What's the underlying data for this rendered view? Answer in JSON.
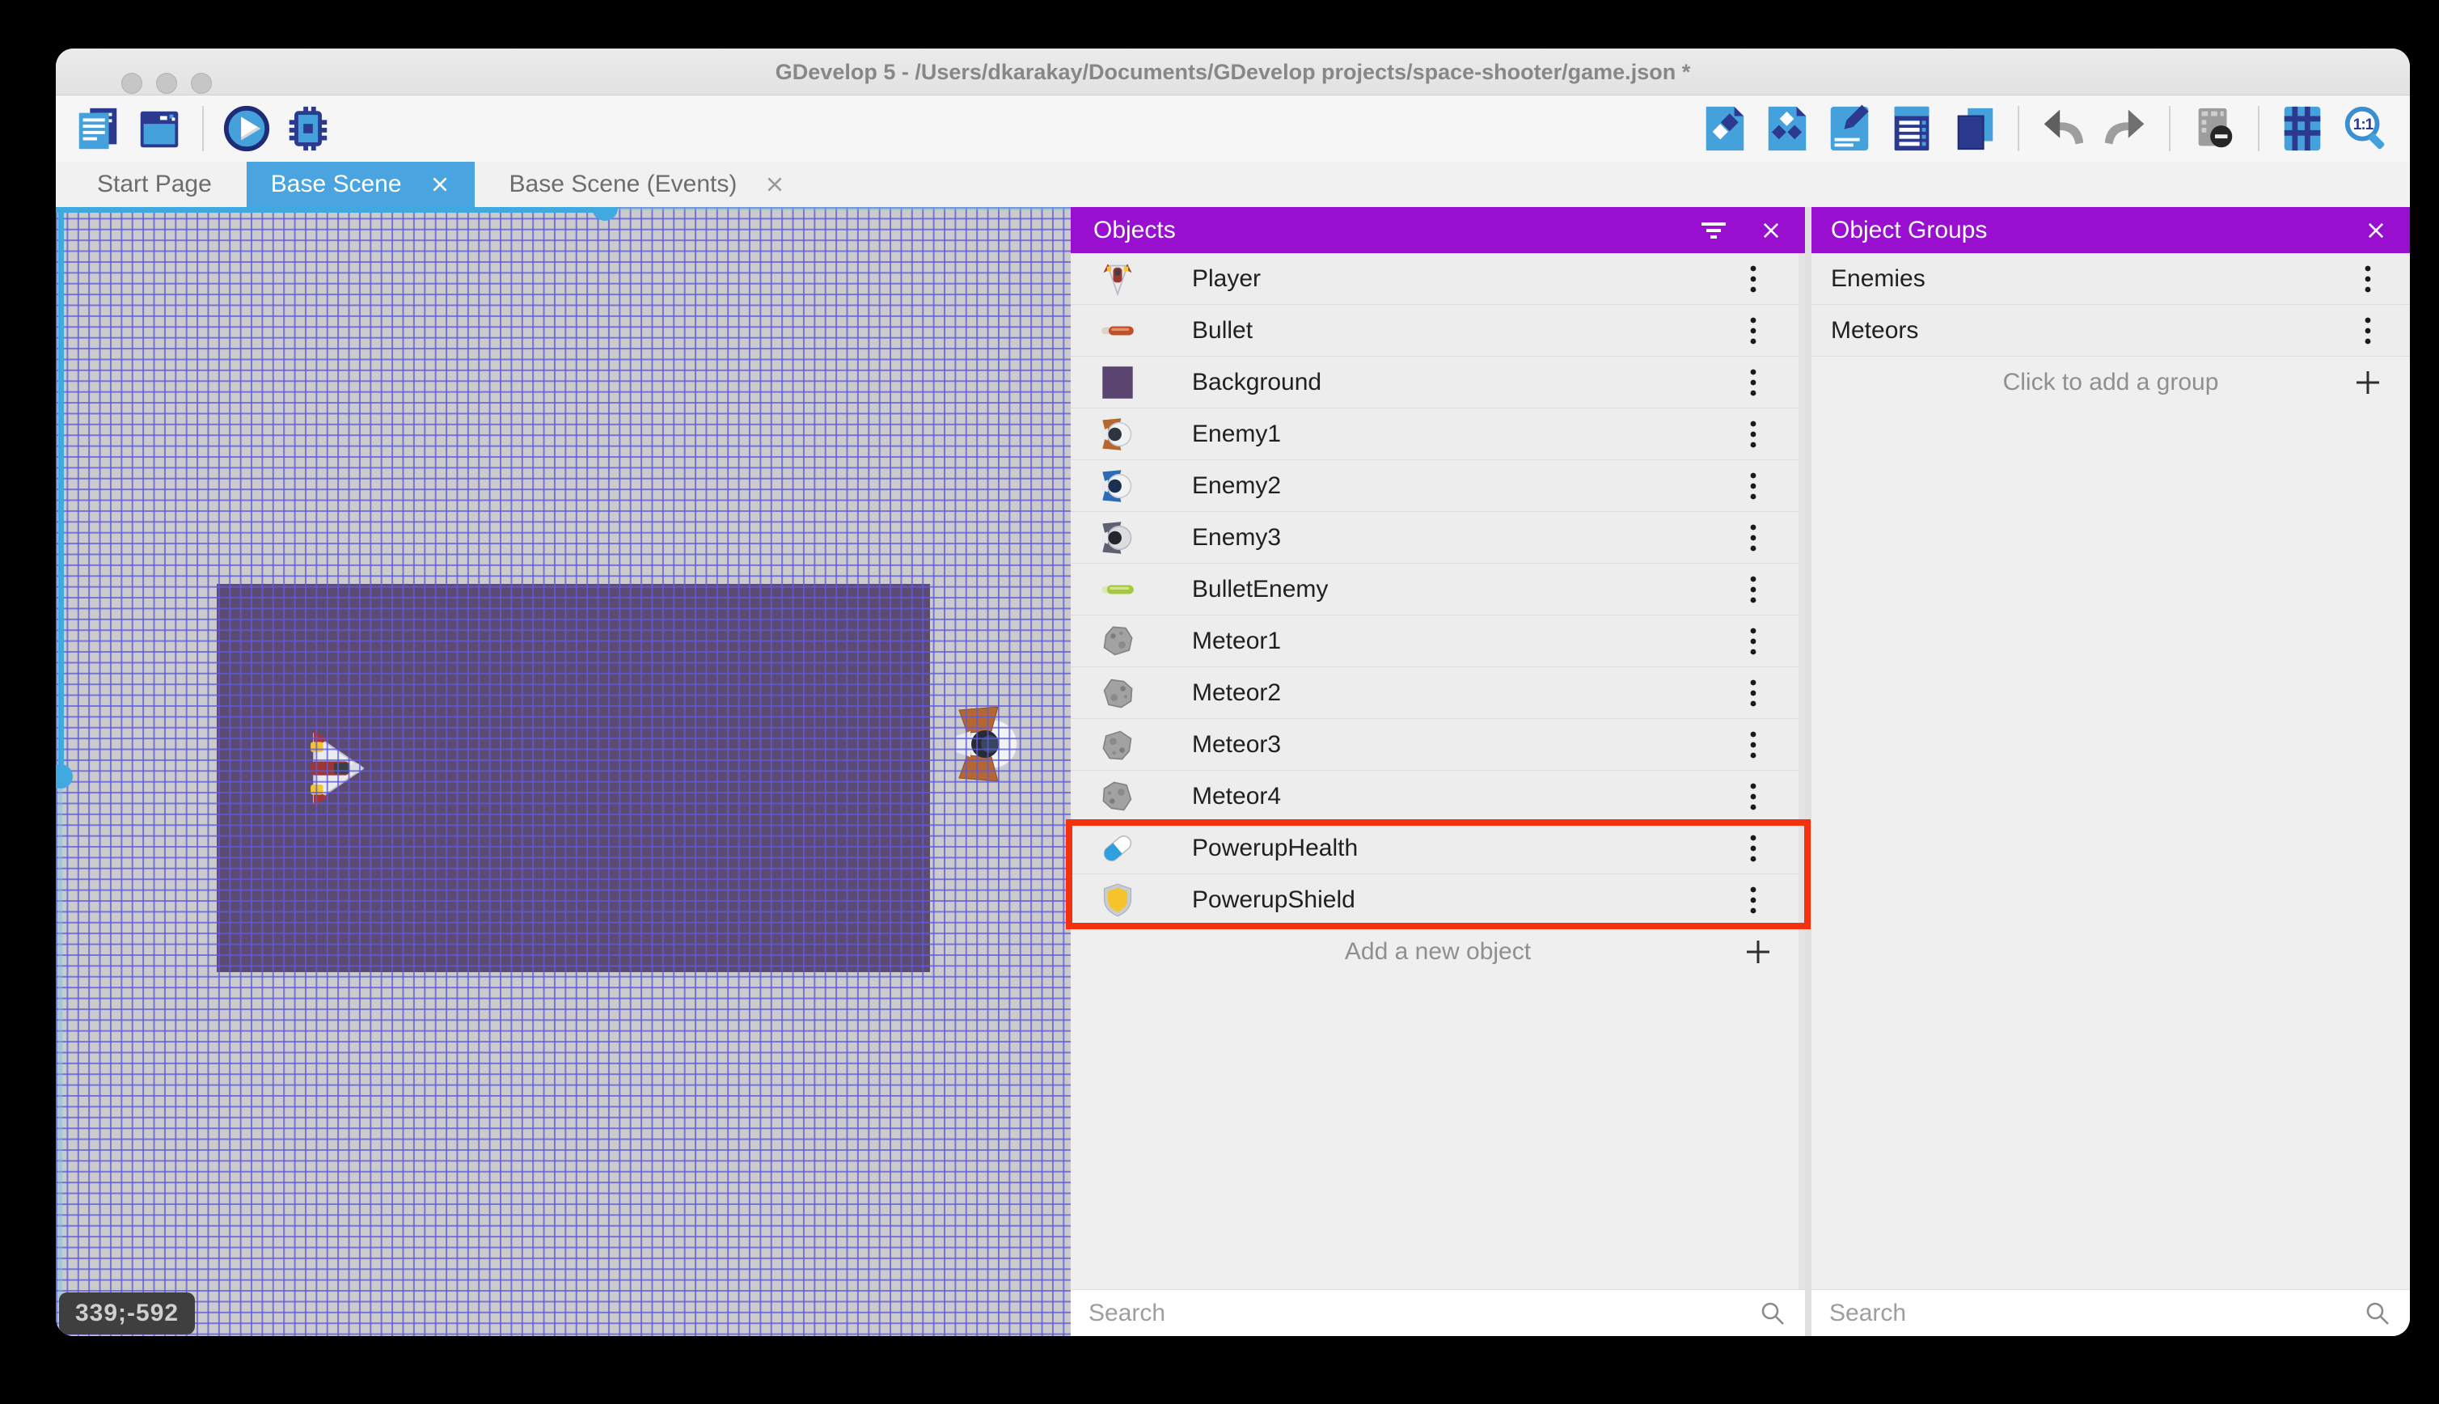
{
  "window": {
    "title": "GDevelop 5 - /Users/dkarakay/Documents/GDevelop projects/space-shooter/game.json *"
  },
  "tabs": {
    "start_page": "Start Page",
    "base_scene": "Base Scene",
    "base_scene_events": "Base Scene (Events)"
  },
  "toolbar": {
    "zoom_ratio_label": "1:1"
  },
  "canvas": {
    "coordinates_badge": "339;-592"
  },
  "objects_panel": {
    "title": "Objects",
    "search_placeholder": "Search",
    "add_button_label": "Add a new object",
    "items": [
      {
        "label": "Player",
        "icon": "player-icon"
      },
      {
        "label": "Bullet",
        "icon": "bullet-icon"
      },
      {
        "label": "Background",
        "icon": "background-icon"
      },
      {
        "label": "Enemy1",
        "icon": "enemy1-icon"
      },
      {
        "label": "Enemy2",
        "icon": "enemy2-icon"
      },
      {
        "label": "Enemy3",
        "icon": "enemy3-icon"
      },
      {
        "label": "BulletEnemy",
        "icon": "bullet-enemy-icon"
      },
      {
        "label": "Meteor1",
        "icon": "meteor-icon"
      },
      {
        "label": "Meteor2",
        "icon": "meteor-icon"
      },
      {
        "label": "Meteor3",
        "icon": "meteor-icon"
      },
      {
        "label": "Meteor4",
        "icon": "meteor-icon"
      },
      {
        "label": "PowerupHealth",
        "icon": "powerup-health-icon"
      },
      {
        "label": "PowerupShield",
        "icon": "powerup-shield-icon"
      }
    ]
  },
  "object_groups_panel": {
    "title": "Object Groups",
    "search_placeholder": "Search",
    "add_button_label": "Click to add a group",
    "items": [
      {
        "label": "Enemies"
      },
      {
        "label": "Meteors"
      }
    ]
  },
  "colors": {
    "panel_header_purple": "#990fd0",
    "active_tab_blue": "#49a4df",
    "selection_highlight_red": "#f4300e",
    "background_object_purple": "#5d4a73",
    "grid_line_blue": "#5e5adb",
    "scene_border_blue": "#3fa9e0",
    "coords_badge_bg": "#3f3f3f"
  }
}
